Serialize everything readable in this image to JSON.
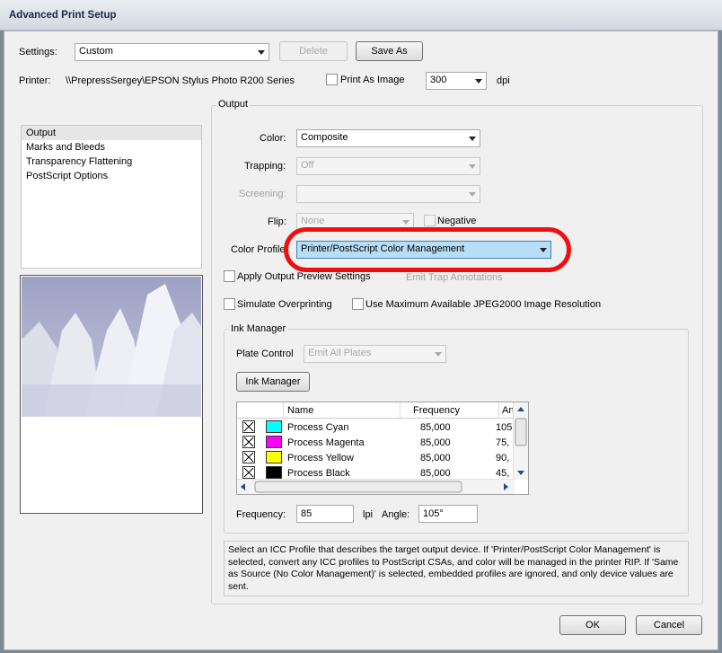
{
  "window": {
    "title": "Advanced Print Setup"
  },
  "settings": {
    "label": "Settings:",
    "value": "Custom",
    "delete_label": "Delete",
    "save_as_label": "Save As"
  },
  "printer": {
    "label": "Printer:",
    "name": "\\\\PrepressSergey\\EPSON Stylus Photo R200 Series",
    "print_as_image": "Print As Image",
    "dpi_value": "300",
    "dpi_unit": "dpi"
  },
  "nav": {
    "items": [
      "Output",
      "Marks and Bleeds",
      "Transparency Flattening",
      "PostScript Options"
    ],
    "selected": "Output"
  },
  "output": {
    "group_title": "Output",
    "color_label": "Color:",
    "color_value": "Composite",
    "trapping_label": "Trapping:",
    "trapping_value": "Off",
    "screening_label": "Screening:",
    "screening_value": "",
    "flip_label": "Flip:",
    "flip_value": "None",
    "negative_label": "Negative",
    "color_profile_label": "Color Profile:",
    "color_profile_value": "Printer/PostScript Color Management",
    "apply_preview_label": "Apply Output Preview Settings",
    "emit_trap_label": "Emit Trap Annotations",
    "simulate_overprint_label": "Simulate Overprinting",
    "jpeg2000_label": "Use Maximum Available JPEG2000 Image Resolution"
  },
  "ink_manager": {
    "group_title": "Ink Manager",
    "plate_control_label": "Plate Control",
    "plate_control_value": "Emit All Plates",
    "button_label": "Ink Manager",
    "columns": [
      "Name",
      "Frequency",
      "An"
    ],
    "rows": [
      {
        "name": "Process Cyan",
        "frequency": "85,000",
        "angle": "105",
        "color": "#00ffff"
      },
      {
        "name": "Process Magenta",
        "frequency": "85,000",
        "angle": "75,",
        "color": "#ff00ff"
      },
      {
        "name": "Process Yellow",
        "frequency": "85,000",
        "angle": "90,",
        "color": "#ffff00"
      },
      {
        "name": "Process Black",
        "frequency": "85,000",
        "angle": "45,",
        "color": "#000000"
      }
    ],
    "frequency_label": "Frequency:",
    "frequency_value": "85",
    "frequency_unit": "lpi",
    "angle_label": "Angle:",
    "angle_value": "105°"
  },
  "description": "Select an ICC Profile that describes the target output device. If 'Printer/PostScript Color Management' is selected, convert any ICC profiles to PostScript CSAs, and color will be managed in the printer RIP. If 'Same as Source (No Color Management)' is selected, embedded profiles are ignored, and only device values are sent.",
  "footer": {
    "ok_label": "OK",
    "cancel_label": "Cancel"
  },
  "colors": {
    "highlight_ring": "#ee1010",
    "selected_profile_bg": "#b8ddf6"
  }
}
